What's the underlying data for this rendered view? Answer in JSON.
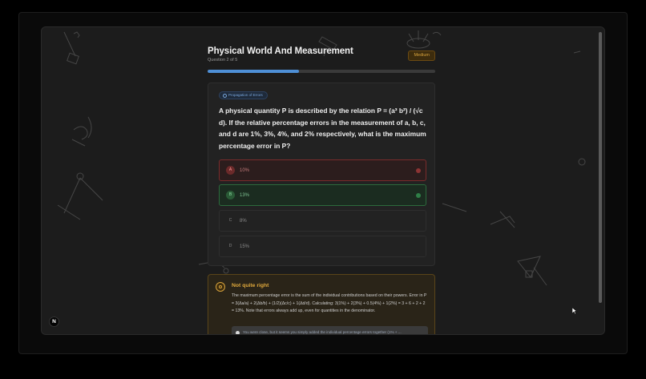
{
  "quiz": {
    "title": "Physical World And Measurement",
    "progress_text": "Question 2 of 5",
    "progress_fraction": 0.4,
    "difficulty": "Medium"
  },
  "question": {
    "topic": "Propagation of Errors",
    "text": "A physical quantity P is described by the relation P = (a³ b²) / (√c d). If the relative percentage errors in the measurement of a, b, c, and d are 1%, 3%, 4%, and 2% respectively, what is the maximum percentage error in P?",
    "options": [
      {
        "letter": "A",
        "text": "10%",
        "state": "wrong"
      },
      {
        "letter": "B",
        "text": "13%",
        "state": "correct"
      },
      {
        "letter": "C",
        "text": "8%",
        "state": "neutral"
      },
      {
        "letter": "D",
        "text": "15%",
        "state": "neutral"
      }
    ]
  },
  "feedback": {
    "title": "Not quite right",
    "body": "The maximum percentage error is the sum of the individual contributions based on their powers. Error in P = 3(Δa/a) + 2(Δb/b) + (1/2)(Δc/c) + 1(Δd/d). Calculating: 3(1%) + 2(3%) + 0.5(4%) + 1(2%) = 3 + 6 + 2 + 2 = 13%. Note that errors always add up, even for quantities in the denominator.",
    "hint": "You were close, but it seems you simply added the individual percentage errors together (1% + ..."
  },
  "app_badge": "N",
  "colors": {
    "accent": "#4e8fd6",
    "warning": "#d6a23d",
    "wrong": "#8c3434",
    "correct": "#2f7f47"
  }
}
